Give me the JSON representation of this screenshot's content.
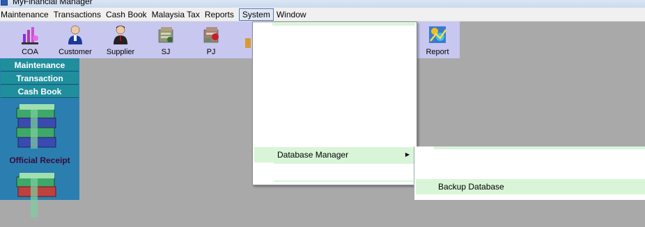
{
  "window": {
    "title": "MyFinancial Manager"
  },
  "menubar": {
    "items": [
      "Maintenance",
      "Transactions",
      "Cash Book",
      "Malaysia Tax",
      "Reports",
      "System",
      "Window"
    ],
    "active": "System"
  },
  "toolbar": {
    "buttons": [
      {
        "label": "COA",
        "icon": "coa-chart-icon"
      },
      {
        "label": "Customer",
        "icon": "customer-person-icon"
      },
      {
        "label": "Supplier",
        "icon": "supplier-person-icon"
      },
      {
        "label": "SJ",
        "icon": "sales-journal-icon"
      },
      {
        "label": "PJ",
        "icon": "purchase-journal-icon"
      },
      {
        "label": "Report",
        "icon": "report-icon"
      }
    ]
  },
  "sidebar": {
    "headers": [
      "Maintenance",
      "Transaction",
      "Cash Book"
    ],
    "items": [
      {
        "label": "Official Receipt",
        "icon": "money-stack-icon"
      }
    ]
  },
  "system_menu": {
    "items": [
      {
        "label": "Database Manager",
        "has_submenu": true
      }
    ]
  },
  "database_submenu": {
    "items": [
      {
        "label": "Backup Database"
      }
    ]
  },
  "colors": {
    "toolbar_bg": "#c7c7f0",
    "sidebar_header": "#1f8f9c",
    "menu_highlight": "#d8f5d8",
    "workspace": "#a9a9a9"
  }
}
